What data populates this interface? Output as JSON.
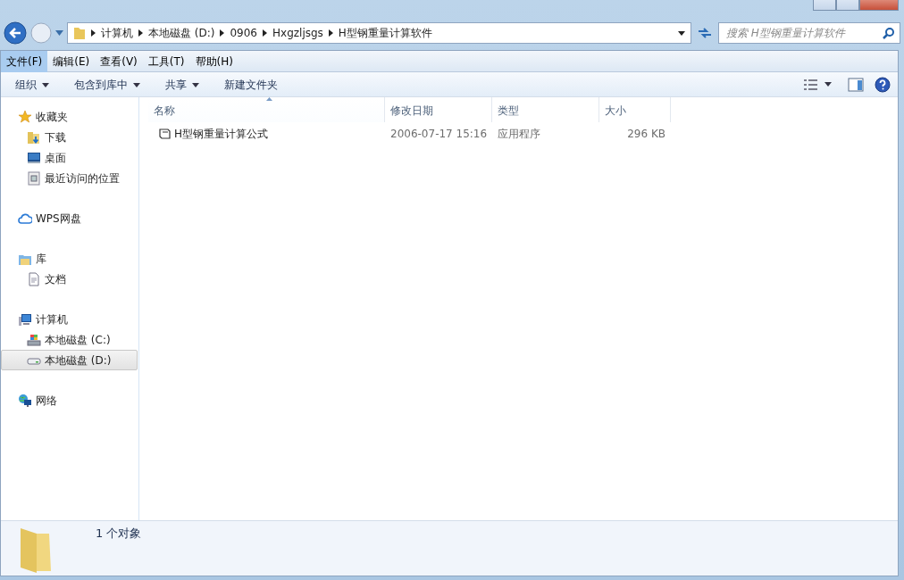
{
  "breadcrumb": [
    "计算机",
    "本地磁盘 (D:)",
    "0906",
    "Hxgzljsgs",
    "H型钢重量计算软件"
  ],
  "search": {
    "placeholder": "搜索 H型钢重量计算软件"
  },
  "menu": [
    {
      "label": "文件(F)",
      "selected": true
    },
    {
      "label": "编辑(E)",
      "selected": false
    },
    {
      "label": "查看(V)",
      "selected": false
    },
    {
      "label": "工具(T)",
      "selected": false
    },
    {
      "label": "帮助(H)",
      "selected": false
    }
  ],
  "toolbar": [
    {
      "label": "组织",
      "kind": "dropdown"
    },
    {
      "label": "包含到库中",
      "kind": "dropdown"
    },
    {
      "label": "共享",
      "kind": "dropdown"
    },
    {
      "label": "新建文件夹",
      "kind": "button"
    }
  ],
  "sidebar": [
    {
      "label": "收藏夹",
      "kind": "star",
      "selected": false,
      "children": [
        {
          "label": "下载",
          "kind": "download",
          "selected": false
        },
        {
          "label": "桌面",
          "kind": "desktop",
          "selected": false
        },
        {
          "label": "最近访问的位置",
          "kind": "recent",
          "selected": false
        }
      ]
    },
    {
      "label": "WPS网盘",
      "kind": "cloud",
      "selected": false
    },
    {
      "label": "库",
      "kind": "library",
      "selected": false,
      "children": [
        {
          "label": "文档",
          "kind": "document",
          "selected": false
        }
      ]
    },
    {
      "label": "计算机",
      "kind": "computer",
      "selected": false,
      "children": [
        {
          "label": "本地磁盘 (C:)",
          "kind": "sysdrive",
          "selected": false
        },
        {
          "label": "本地磁盘 (D:)",
          "kind": "drive",
          "selected": true
        }
      ]
    },
    {
      "label": "网络",
      "kind": "network",
      "selected": false
    }
  ],
  "columns": [
    {
      "label": "名称",
      "sorted": true
    },
    {
      "label": "修改日期",
      "sorted": false
    },
    {
      "label": "类型",
      "sorted": false
    },
    {
      "label": "大小",
      "sorted": false
    }
  ],
  "rows": [
    {
      "name": "H型钢重量计算公式",
      "date": "2006-07-17 15:16",
      "type": "应用程序",
      "size": "296 KB"
    }
  ],
  "status": {
    "count": "1 个对象"
  }
}
